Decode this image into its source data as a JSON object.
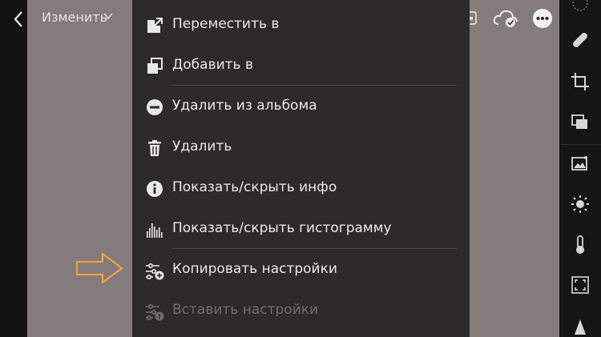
{
  "topbar": {
    "edit_label": "Изменить",
    "back_icon": "chevron-left-icon",
    "caret_icon": "chevron-down-icon",
    "right_icons": [
      "copy-icon",
      "cloud-sync-icon",
      "more-icon"
    ]
  },
  "menu": {
    "items": [
      {
        "label": "Переместить в",
        "icon": "move-to-icon",
        "enabled": true
      },
      {
        "label": "Добавить в",
        "icon": "add-to-icon",
        "enabled": true
      },
      {
        "label": "Удалить из альбома",
        "icon": "minus-circle-icon",
        "enabled": true
      },
      {
        "label": "Удалить",
        "icon": "trash-icon",
        "enabled": true
      },
      {
        "label": "Показать/скрыть инфо",
        "icon": "info-icon",
        "enabled": true
      },
      {
        "label": "Показать/скрыть гистограмму",
        "icon": "histogram-icon",
        "enabled": true
      },
      {
        "label": "Копировать настройки",
        "icon": "copy-settings-icon",
        "enabled": true
      },
      {
        "label": "Вставить настройки",
        "icon": "paste-settings-icon",
        "enabled": false
      }
    ]
  },
  "annotation": {
    "arrow_color": "#f0a33a",
    "points_to": "Копировать настройки"
  },
  "right_panel": {
    "icons": [
      "presets-icon",
      "healing-icon",
      "crop-icon",
      "versions-icon",
      "auto-icon",
      "light-icon",
      "color-icon",
      "geometry-icon",
      "detail-icon"
    ]
  },
  "colors": {
    "menu_bg": "#2c2a2a",
    "photo_bg": "#847b7d",
    "text": "#e9e9e9",
    "disabled_text": "#6e6e6e"
  }
}
